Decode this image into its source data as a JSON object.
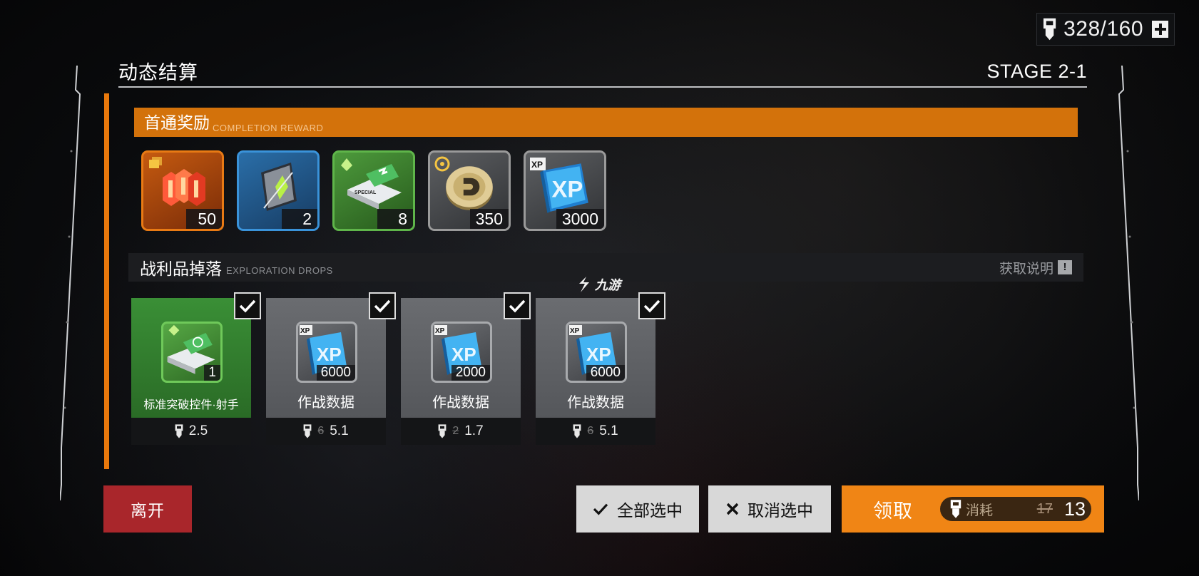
{
  "colors": {
    "accent_orange": "#e8780c",
    "leave_red": "#a9262b",
    "claim_orange": "#f08515"
  },
  "stamina": {
    "icon": "stamina-icon",
    "value": "328/160"
  },
  "header": {
    "title": "动态结算",
    "stage": "STAGE 2-1"
  },
  "completion": {
    "title_zh": "首通奖励",
    "title_en": "COMPLETION REWARD",
    "items": [
      {
        "icon": "red-material-icon",
        "rarity": "orange",
        "count": "50"
      },
      {
        "icon": "blue-card-icon",
        "rarity": "blue",
        "count": "2"
      },
      {
        "icon": "special-module-icon",
        "rarity": "green",
        "count": "8"
      },
      {
        "icon": "coin-icon",
        "rarity": "grey",
        "count": "350"
      },
      {
        "icon": "xp-data-icon",
        "rarity": "grey",
        "count": "3000"
      }
    ]
  },
  "drops": {
    "title_zh": "战利品掉落",
    "title_en": "EXPLORATION DROPS",
    "info_label": "获取说明",
    "items": [
      {
        "name": "标准突破控件·射手",
        "count": "1",
        "old_cost": "",
        "cost": "2.5",
        "checked": true
      },
      {
        "name": "作战数据",
        "count": "6000",
        "old_cost": "6",
        "cost": "5.1",
        "checked": true
      },
      {
        "name": "作战数据",
        "count": "2000",
        "old_cost": "2",
        "cost": "1.7",
        "checked": true
      },
      {
        "name": "作战数据",
        "count": "6000",
        "old_cost": "6",
        "cost": "5.1",
        "checked": true
      }
    ]
  },
  "watermark": {
    "text": "九游"
  },
  "buttons": {
    "leave": "离开",
    "select_all": "全部选中",
    "deselect": "取消选中",
    "claim": "领取",
    "cost_word": "消耗",
    "cost_old": "17",
    "cost_new": "13"
  }
}
